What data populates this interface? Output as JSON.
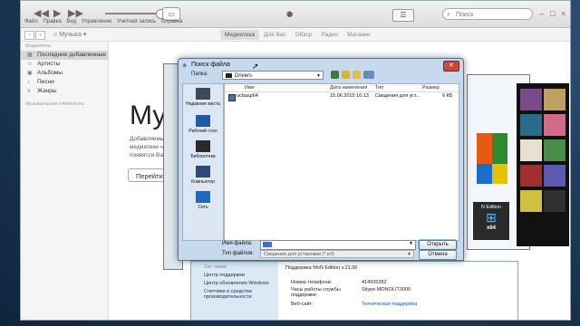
{
  "itunes": {
    "menu": [
      "Файл",
      "Правка",
      "Вид",
      "Управление",
      "Учетная запись",
      "Справка"
    ],
    "library_select": "Музыка",
    "search_placeholder": "Поиск",
    "tabs": [
      "Медиатека",
      "Для Вас",
      "Обзор",
      "Радио",
      "Магазин"
    ],
    "active_tab": "Медиатека",
    "sidebar_header": "Медиатека",
    "sidebar_items": [
      "Последние добавленные",
      "Артисты",
      "Альбомы",
      "Песни",
      "Жанры"
    ],
    "sidebar_footer": "Музыкальные плейлисты",
    "main_title": "Музы",
    "main_desc": [
      "Добавляемые",
      "медиатеки «М",
      "появятся Ваш"
    ],
    "goto_button": "Перейти в"
  },
  "dialog": {
    "title": "Поиск файла",
    "look_in_label": "Папка:",
    "look_in_value": "Drivers",
    "places": [
      "Недавние места",
      "Рабочий стол",
      "Библиотеки",
      "Компьютер",
      "Сеть"
    ],
    "columns": [
      "Имя",
      "Дата изменения",
      "Тип",
      "Размер"
    ],
    "files": [
      {
        "name": "ucbasp64",
        "date": "15.06.2015 16:13",
        "type": "Сведения для уст...",
        "size": "6 КБ"
      }
    ],
    "file_name_label": "Имя файла:",
    "file_type_label": "Тип файлов:",
    "file_type_value": "Сведения для установки (*.inf)",
    "open_button": "Открыть",
    "cancel_button": "Отмена"
  },
  "system_info": {
    "see_also": "См. также",
    "links": [
      "Центр поддержки",
      "Центр обновления Windows",
      "Счетчики и средства производительности"
    ],
    "support_title": "Поддержка MoN Edition v.21.06",
    "rows": [
      {
        "label": "Номер телефона:",
        "value": "414926282"
      },
      {
        "label": "Часы работы службы поддержки:",
        "value": "Skype MONOLIT3000"
      },
      {
        "label": "Веб-сайт:",
        "value": "Техническая поддержка"
      }
    ],
    "badge_edition": "N Edition",
    "badge_bits": "x64"
  }
}
